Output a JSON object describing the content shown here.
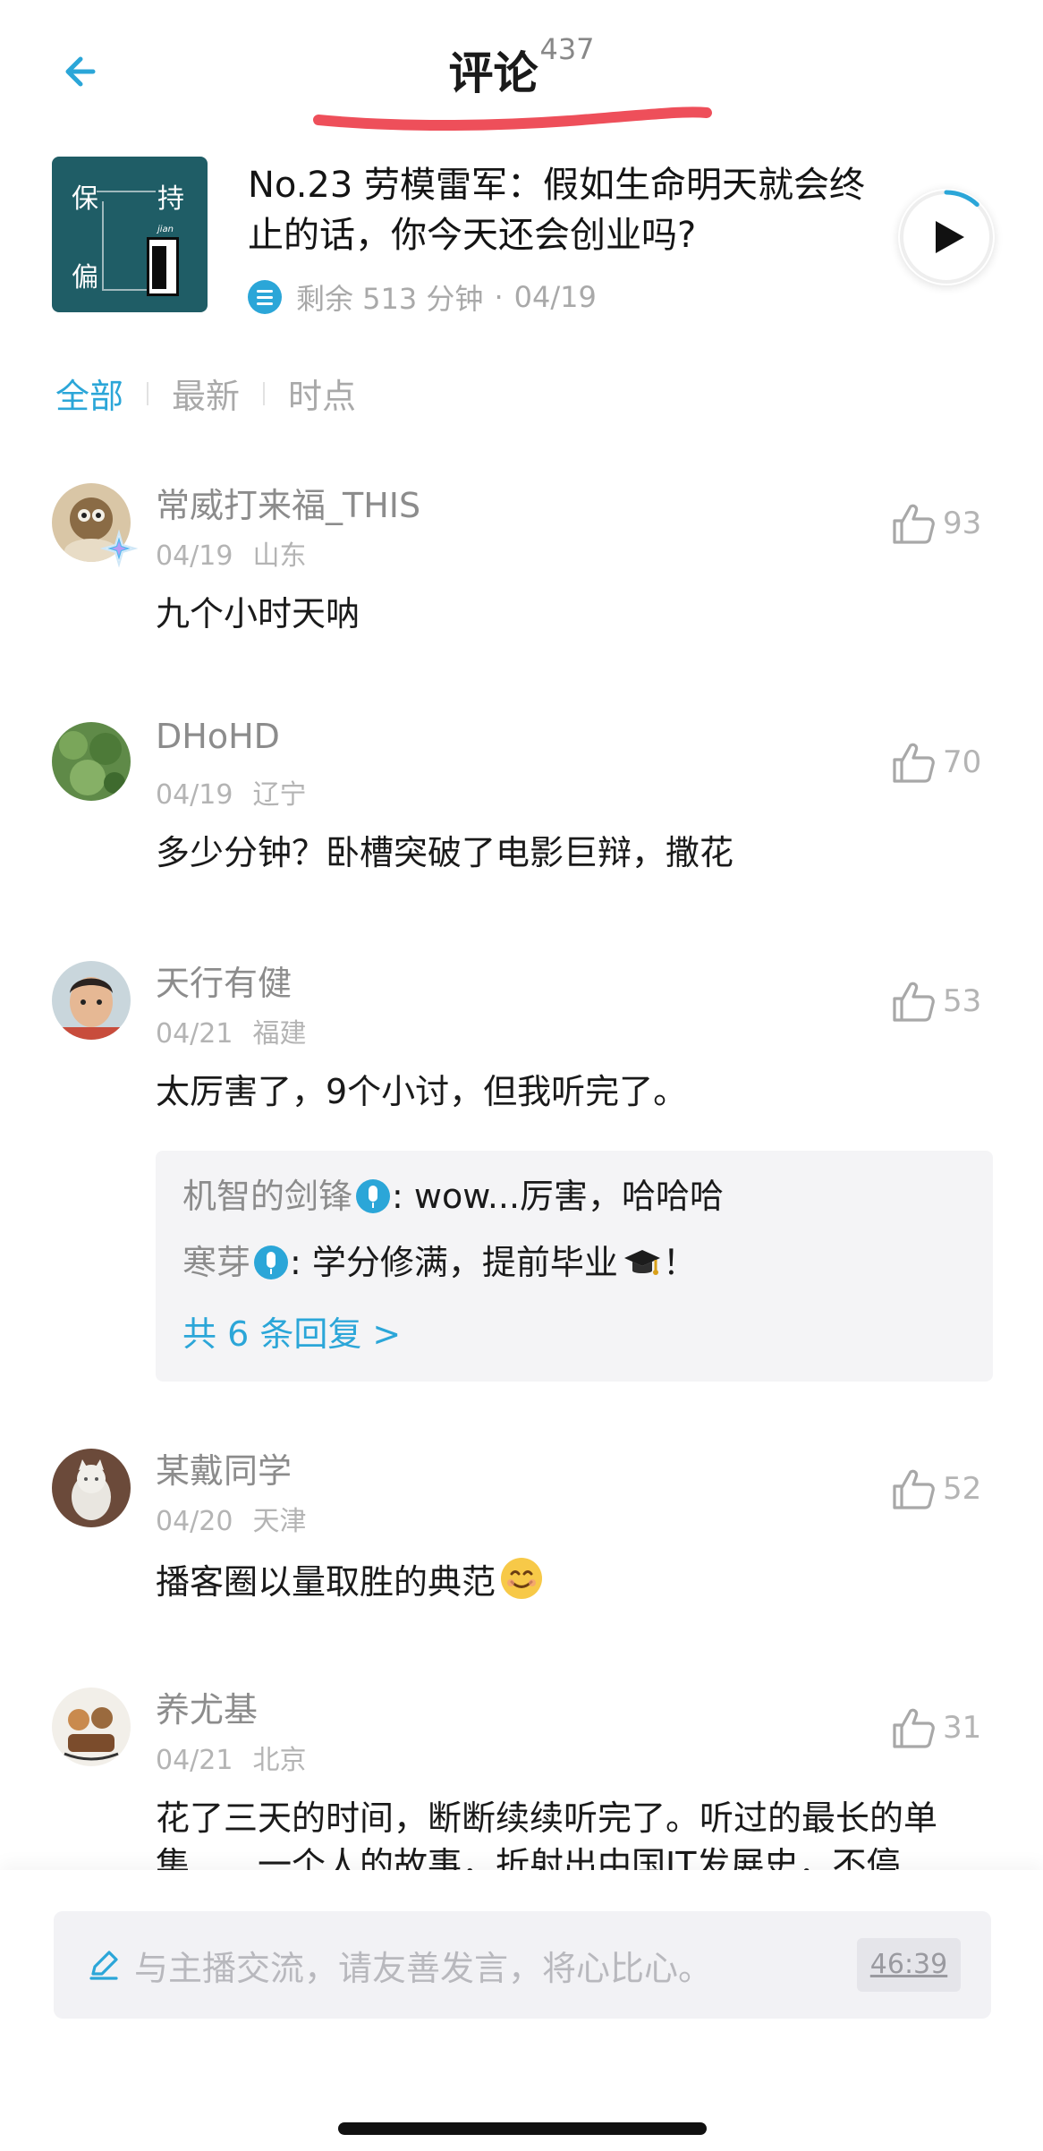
{
  "header": {
    "title": "评论",
    "count": "437",
    "back_icon": "back-arrow-icon",
    "accent": "#2ba6d8",
    "scribble_color": "#ee4f5a"
  },
  "episode": {
    "cover_chars": [
      "保",
      "持",
      "偏"
    ],
    "cover_small": "jian",
    "title": "No.23 劳模雷军：假如生命明天就会终止的话，你今天还会创业吗?",
    "remaining": "剩余 513 分钟",
    "dot": "·",
    "date": "04/19",
    "playback_progress": 0.12
  },
  "tabs": [
    {
      "label": "全部",
      "active": true
    },
    {
      "label": "最新",
      "active": false
    },
    {
      "label": "时点",
      "active": false
    }
  ],
  "comments": [
    {
      "username": "常威打来福_THIS",
      "date": "04/19",
      "location": "山东",
      "likes": "93",
      "text": "九个小时天呐"
    },
    {
      "username": "DHoHD",
      "date": "04/19",
      "location": "辽宁",
      "likes": "70",
      "text": "多少分钟？卧槽突破了电影巨辩，撒花"
    },
    {
      "username": "天行有健",
      "date": "04/21",
      "location": "福建",
      "likes": "53",
      "text": "太厉害了，9个小讨，但我听完了。",
      "replies": [
        {
          "name": "机智的剑锋",
          "text": ": wow...厉害，哈哈哈"
        },
        {
          "name": "寒芽",
          "text": ": 学分修满，提前毕业",
          "suffix": "！"
        }
      ],
      "more": "共 6 条回复 >"
    },
    {
      "username": "某戴同学",
      "date": "04/20",
      "location": "天津",
      "likes": "52",
      "text": "播客圈以量取胜的典范"
    },
    {
      "username": "养尤基",
      "date": "04/21",
      "location": "北京",
      "likes": "31",
      "text": "花了三天的时间，断断续续听完了。听过的最长的单集……一个人的故事，折射出中国IT发展史，不停"
    }
  ],
  "composer": {
    "placeholder": "与主播交流，请友善发言，将心比心。",
    "timestamp": "46:39"
  }
}
